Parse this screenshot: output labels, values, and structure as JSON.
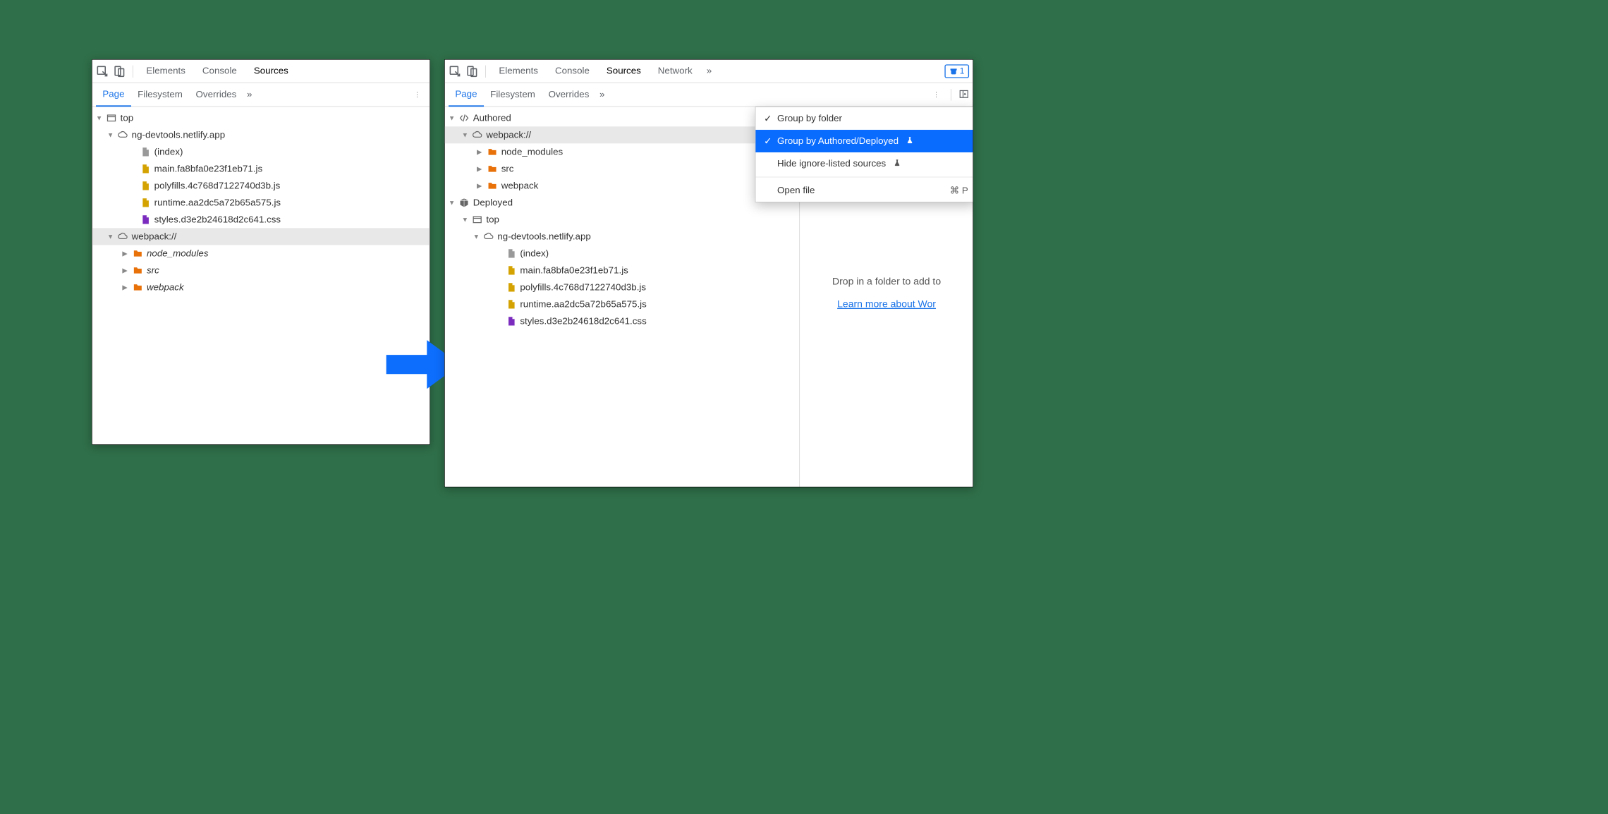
{
  "left_panel": {
    "tabs": [
      "Elements",
      "Console",
      "Sources"
    ],
    "active_tab": "Sources",
    "subtabs": [
      "Page",
      "Filesystem",
      "Overrides"
    ],
    "active_subtab": "Page",
    "tree": {
      "top": "top",
      "domain": "ng-devtools.netlify.app",
      "files": [
        "(index)",
        "main.fa8bfa0e23f1eb71.js",
        "polyfills.4c768d7122740d3b.js",
        "runtime.aa2dc5a72b65a575.js",
        "styles.d3e2b24618d2c641.css"
      ],
      "webpack": {
        "label": "webpack://",
        "folders": [
          "node_modules",
          "src",
          "webpack"
        ]
      }
    }
  },
  "right_panel": {
    "tabs": [
      "Elements",
      "Console",
      "Sources",
      "Network"
    ],
    "active_tab": "Sources",
    "issues_count": "1",
    "subtabs": [
      "Page",
      "Filesystem",
      "Overrides"
    ],
    "active_subtab": "Page",
    "tree": {
      "authored": {
        "label": "Authored",
        "webpack": "webpack://",
        "folders": [
          "node_modules",
          "src",
          "webpack"
        ]
      },
      "deployed": {
        "label": "Deployed",
        "top": "top",
        "domain": "ng-devtools.netlify.app",
        "files": [
          "(index)",
          "main.fa8bfa0e23f1eb71.js",
          "polyfills.4c768d7122740d3b.js",
          "runtime.aa2dc5a72b65a575.js",
          "styles.d3e2b24618d2c641.css"
        ]
      }
    },
    "empty_hint": "Drop in a folder to add to",
    "learn_more": "Learn more about Wor",
    "context_menu": {
      "group_by_folder": "Group by folder",
      "group_by_authored": "Group by Authored/Deployed",
      "hide_ignore": "Hide ignore-listed sources",
      "open_file": "Open file",
      "open_file_shortcut": "⌘ P"
    }
  }
}
